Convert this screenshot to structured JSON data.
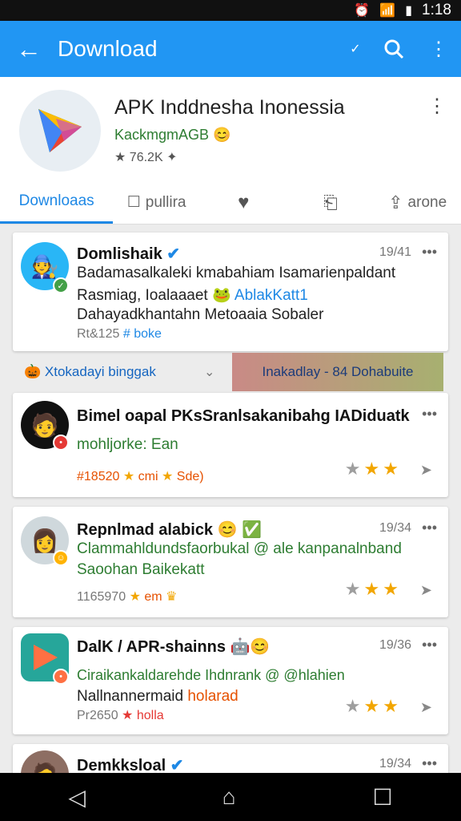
{
  "status": {
    "time": "1:18"
  },
  "appbar": {
    "title": "Download"
  },
  "app": {
    "title": "APK Inddnesha Inonessia",
    "developer": "KackmgmAGB",
    "rating": "76.2K"
  },
  "tabs": [
    {
      "label": "Downloaas"
    },
    {
      "label": "pullira"
    },
    {
      "label": ""
    },
    {
      "label": ""
    },
    {
      "label": "arone"
    }
  ],
  "filter": {
    "left": "Xtokadayi binggak",
    "right": "Inakadlay - 84 Dohabuite"
  },
  "cards": [
    {
      "name": "Domlishaik",
      "time": "19/41",
      "line1": "Badamasalkaleki kmabahiam Isamarienpaldant",
      "line2a": "Rasmiag, Ioalaaaet",
      "line2b": "AblakKatt1",
      "line3": "Dahayadkhantahn Metoaaia Sobaler",
      "meta1": "Rt&125",
      "meta2": "boke"
    },
    {
      "name": "Bimel oapal PKsSranlsakanibahg IADiduatk",
      "line1": "mohljorke: Ean",
      "meta1": "#18520",
      "meta2": "cmi",
      "meta3": "Sde)",
      "stars_on": 2
    },
    {
      "name": "Repnlmad alabick",
      "time": "19/34",
      "line1": "Clammahldundsfaorbukal @ ale kanpanalnband",
      "line2": "Saoohan Baikekatt",
      "meta1": "1165970",
      "meta2": "em",
      "stars_on": 2
    },
    {
      "name": "DalK / APR-shainns",
      "time": "19/36",
      "line1": "Ciraikankaldarehde Ihdnrank @ @hlahien",
      "line2a": "Nallnannermaid",
      "line2b": "holarad",
      "meta1": "Pr2650",
      "meta2": "holla",
      "stars_on": 2
    },
    {
      "name": "Demkksloal",
      "time": "19/34"
    }
  ],
  "colors": {
    "accent": "#2196f3",
    "star": "#f2a600",
    "green": "#2e7d32"
  }
}
